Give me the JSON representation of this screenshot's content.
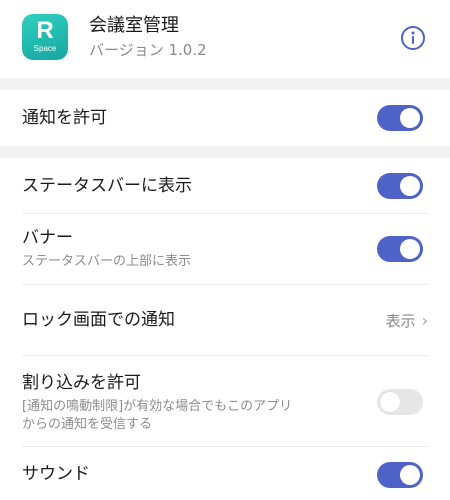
{
  "app": {
    "icon_letter": "R",
    "icon_sub": "Space",
    "icon_color": "#1fb8ad",
    "title": "会議室管理",
    "version": "バージョン 1.0.2",
    "info_icon": "info-icon"
  },
  "settings": {
    "allow_notifications": {
      "label": "通知を許可",
      "enabled": true
    },
    "status_bar": {
      "label": "ステータスバーに表示",
      "enabled": true
    },
    "banner": {
      "label": "バナー",
      "description": "ステータスバーの上部に表示",
      "enabled": true
    },
    "lock_screen": {
      "label": "ロック画面での通知",
      "value": "表示"
    },
    "interrupt": {
      "label": "割り込みを許可",
      "description_line1": "[通知の鳴動制限]が有効な場合でもこのアプリ",
      "description_line2": "からの通知を受信する",
      "enabled": false
    },
    "sound": {
      "label": "サウンド",
      "enabled": true
    }
  },
  "colors": {
    "toggle_on": "#4f62c8",
    "toggle_off": "#e6e6e6",
    "section_gap": "#f2f2f2"
  }
}
